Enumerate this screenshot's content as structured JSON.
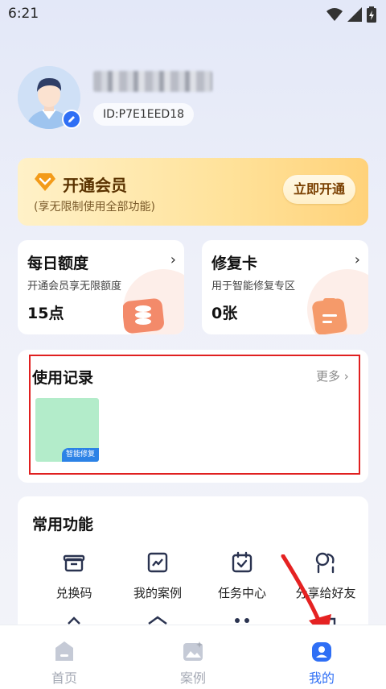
{
  "status_bar": {
    "time": "6:21"
  },
  "profile": {
    "id_label": "ID:P7E1EED18"
  },
  "vip": {
    "title": "开通会员",
    "subtitle": "(享无限制使用全部功能)",
    "button": "立即开通"
  },
  "quota": {
    "daily": {
      "title": "每日额度",
      "desc": "开通会员享无限额度",
      "value": "15点"
    },
    "repair": {
      "title": "修复卡",
      "desc": "用于智能修复专区",
      "value": "0张"
    }
  },
  "records": {
    "title": "使用记录",
    "more": "更多",
    "thumb_badge": "智能修复"
  },
  "functions": {
    "title": "常用功能",
    "items": [
      {
        "label": "兑换码",
        "icon": "gift-icon"
      },
      {
        "label": "我的案例",
        "icon": "image-chart-icon"
      },
      {
        "label": "任务中心",
        "icon": "calendar-check-icon"
      },
      {
        "label": "分享给好友",
        "icon": "share-users-icon"
      }
    ]
  },
  "nav": {
    "items": [
      {
        "label": "首页",
        "icon": "home-icon"
      },
      {
        "label": "案例",
        "icon": "gallery-icon"
      },
      {
        "label": "我的",
        "icon": "profile-icon",
        "active": true
      }
    ]
  },
  "colors": {
    "accent": "#2f6ff5",
    "vip": "#ffd27a",
    "highlight": "#e02020"
  }
}
